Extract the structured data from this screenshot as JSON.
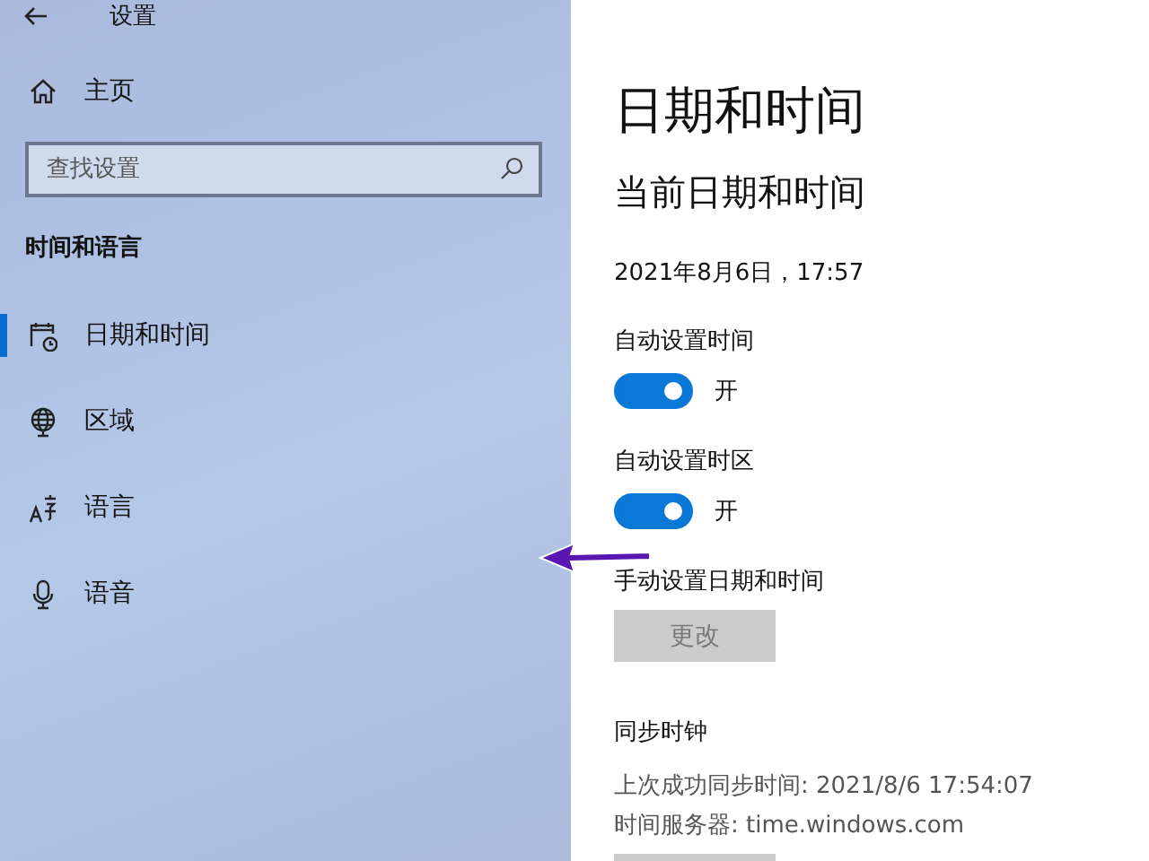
{
  "window": {
    "title": "设置"
  },
  "sidebar": {
    "home": "主页",
    "search": {
      "placeholder": "查找设置"
    },
    "section": "时间和语言",
    "items": [
      {
        "label": "日期和时间",
        "kind": "calendar-clock",
        "selected": true
      },
      {
        "label": "区域",
        "kind": "globe",
        "selected": false
      },
      {
        "label": "语言",
        "kind": "language",
        "selected": false
      },
      {
        "label": "语音",
        "kind": "microphone",
        "selected": false
      }
    ]
  },
  "page": {
    "title": "日期和时间",
    "subtitle": "当前日期和时间",
    "current": "2021年8月6日，17:57",
    "settings": [
      {
        "kind": "toggle",
        "label": "自动设置时间",
        "on": true,
        "state_label": "开"
      },
      {
        "kind": "toggle",
        "label": "自动设置时区",
        "on": true,
        "state_label": "开"
      },
      {
        "kind": "button",
        "label": "手动设置日期和时间",
        "button": "更改",
        "disabled": true
      }
    ],
    "sync": {
      "heading": "同步时钟",
      "lines": [
        "上次成功同步时间: 2021/8/6 17:54:07",
        "时间服务器: time.windows.com"
      ]
    }
  }
}
